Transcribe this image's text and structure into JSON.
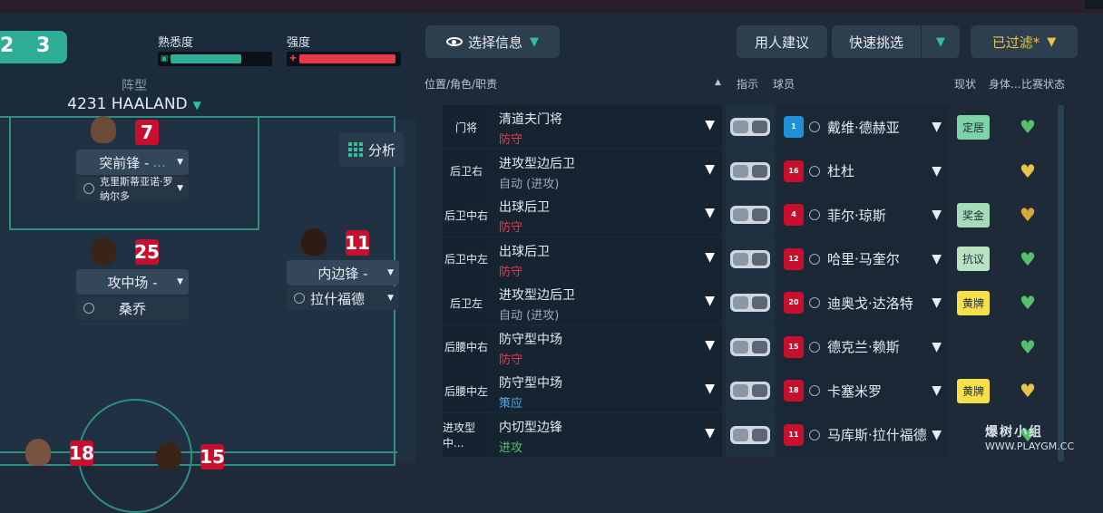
{
  "score": {
    "a": "2",
    "b": "3"
  },
  "meters": {
    "familiarity": {
      "label": "熟悉度",
      "value": 0.72,
      "color": "#2fae97"
    },
    "intensity": {
      "label": "强度",
      "value": 0.98,
      "color": "#e8394a"
    }
  },
  "formation": {
    "label": "阵型",
    "name": "4231 HAALAND"
  },
  "analysis_label": "分析",
  "pitch_players": [
    {
      "number": "7",
      "role": "突前锋 -",
      "role_suffix": "...",
      "name": "克里斯蒂亚诺·罗纳尔多"
    },
    {
      "number": "25",
      "role": "攻中场 -",
      "role_suffix": "",
      "name": "桑乔"
    },
    {
      "number": "11",
      "role": "内边锋 -",
      "role_suffix": "",
      "name": "拉什福德"
    },
    {
      "number": "18",
      "role": "",
      "role_suffix": "",
      "name": ""
    },
    {
      "number": "15",
      "role": "",
      "role_suffix": "",
      "name": ""
    }
  ],
  "toolbar": {
    "select_info": "选择信息",
    "recommend": "用人建议",
    "quick_pick": "快速挑选",
    "filtered": "已过滤*"
  },
  "headers": {
    "position": "位置/角色/职责",
    "instructions": "指示",
    "player": "球员",
    "status": "现状",
    "condition": "身体...",
    "match_status": "比赛状态"
  },
  "rows": [
    {
      "pos": "门将",
      "role": "清道夫门将",
      "duty": "防守",
      "duty_color": "#e8394a",
      "number": "1",
      "gk": true,
      "player": "戴维·德赫亚",
      "tag": "定居",
      "tag_color": "#7fd3a8",
      "heart_color": "#54c06a"
    },
    {
      "pos": "后卫右",
      "role": "进攻型边后卫",
      "duty": "自动 (进攻)",
      "duty_color": "#9aa8b8",
      "number": "16",
      "gk": false,
      "player": "杜杜",
      "tag": "",
      "tag_color": "",
      "heart_color": "#e8c34a"
    },
    {
      "pos": "后卫中右",
      "role": "出球后卫",
      "duty": "防守",
      "duty_color": "#e8394a",
      "number": "4",
      "gk": false,
      "player": "菲尔·琼斯",
      "tag": "奖金",
      "tag_color": "#a5dcb8",
      "heart_color": "#d8a93a"
    },
    {
      "pos": "后卫中左",
      "role": "出球后卫",
      "duty": "防守",
      "duty_color": "#e8394a",
      "number": "12",
      "gk": false,
      "player": "哈里·马奎尔",
      "tag": "抗议",
      "tag_color": "#b8e2c0",
      "heart_color": "#54c06a"
    },
    {
      "pos": "后卫左",
      "role": "进攻型边后卫",
      "duty": "自动 (进攻)",
      "duty_color": "#9aa8b8",
      "number": "20",
      "gk": false,
      "player": "迪奥戈·达洛特",
      "tag": "黄牌",
      "tag_color": "#f5e04a",
      "heart_color": "#54c06a"
    },
    {
      "pos": "后腰中右",
      "role": "防守型中场",
      "duty": "防守",
      "duty_color": "#e8394a",
      "number": "15",
      "gk": false,
      "player": "德克兰·赖斯",
      "tag": "",
      "tag_color": "",
      "heart_color": "#54c06a"
    },
    {
      "pos": "后腰中左",
      "role": "防守型中场",
      "duty": "策应",
      "duty_color": "#5aa6e6",
      "number": "18",
      "gk": false,
      "player": "卡塞米罗",
      "tag": "黄牌",
      "tag_color": "#f5e04a",
      "heart_color": "#e8c34a"
    },
    {
      "pos": "进攻型中...",
      "role": "内切型边锋",
      "duty": "进攻",
      "duty_color": "#54c06a",
      "number": "11",
      "gk": false,
      "player": "马库斯·拉什福德",
      "tag": "",
      "tag_color": "",
      "heart_color": "#54c06a"
    }
  ],
  "watermark": {
    "title": "爆树小组",
    "site": "WWW.PLAYGM.CC"
  }
}
